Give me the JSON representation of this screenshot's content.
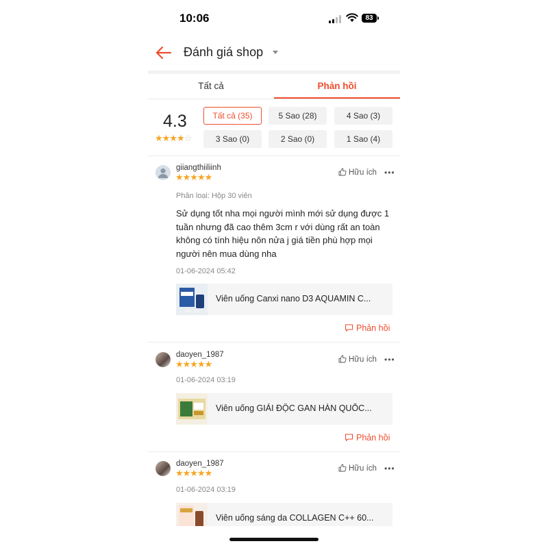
{
  "status_bar": {
    "time": "10:06",
    "battery": "83"
  },
  "header": {
    "title": "Đánh giá shop"
  },
  "tabs": [
    {
      "label": "Tất cả"
    },
    {
      "label": "Phản hồi"
    }
  ],
  "summary": {
    "score": "4.3",
    "stars": 4,
    "filters": [
      {
        "label": "Tất cả (35)"
      },
      {
        "label": "5 Sao (28)"
      },
      {
        "label": "4 Sao (3)"
      },
      {
        "label": "3 Sao (0)"
      },
      {
        "label": "2 Sao (0)"
      },
      {
        "label": "1 Sao (4)"
      }
    ]
  },
  "reviews": [
    {
      "username": "giiangthiiliinh",
      "stars": "★★★★★",
      "helpful_label": "Hữu ích",
      "variant": "Phân loại: Hộp 30 viên",
      "comment": "Sử dụng tốt nha mọi người mình mới sử dụng được 1 tuần nhưng đã cao thêm 3cm r với dùng rất an toàn không có tính hiệu nôn nửa j giá tiền phù hợp mọi người nên mua dùng nha",
      "date": "01-06-2024 05:42",
      "product": "Viên uống Canxi nano D3 AQUAMIN C...",
      "reply_label": "Phản hồi"
    },
    {
      "username": "daoyen_1987",
      "stars": "★★★★★",
      "helpful_label": "Hữu ích",
      "date": "01-06-2024 03:19",
      "product": "Viên uống GIẢI ĐỘC GAN HÀN QUỐC...",
      "reply_label": "Phản hồi"
    },
    {
      "username": "daoyen_1987",
      "stars": "★★★★★",
      "helpful_label": "Hữu ích",
      "date": "01-06-2024 03:19",
      "product": "Viên uống sáng da COLLAGEN C++ 60..."
    }
  ],
  "colors": {
    "accent": "#ee4d2d",
    "star": "#f5a623"
  }
}
